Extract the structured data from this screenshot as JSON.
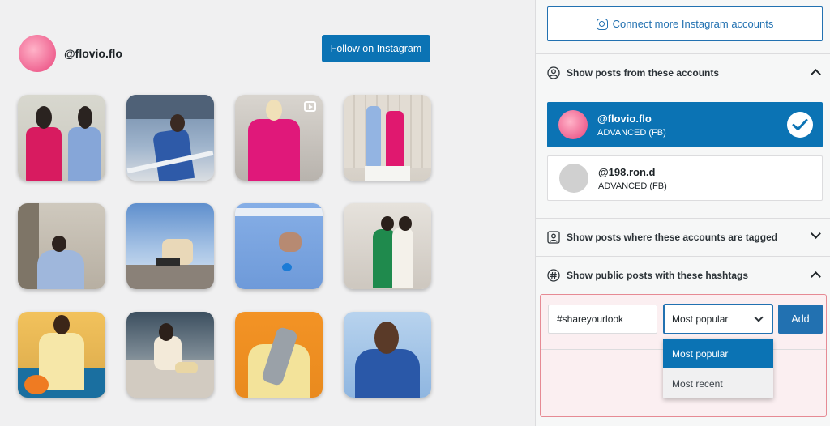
{
  "preview": {
    "username": "@flovio.flo",
    "follow_label": "Follow on Instagram"
  },
  "panel": {
    "connect_label": "Connect more Instagram accounts",
    "sections": {
      "accounts": "Show posts from these accounts",
      "tagged": "Show posts where these accounts are tagged",
      "hashtags": "Show public posts with these hashtags"
    },
    "accounts": [
      {
        "name": "@flovio.flo",
        "type": "ADVANCED (FB)",
        "selected": true
      },
      {
        "name": "@198.ron.d",
        "type": "ADVANCED (FB)",
        "selected": false
      }
    ],
    "hashtag": {
      "input_value": "#shareyourlook",
      "selected_option": "Most popular",
      "options": [
        "Most popular",
        "Most recent"
      ],
      "add_label": "Add"
    }
  },
  "colors": {
    "accent": "#0b73b4",
    "link": "#2271b1",
    "error_border": "#e68a94"
  },
  "icons": {
    "instagram": "instagram-icon",
    "user": "user-circle-icon",
    "tagged": "tagged-user-icon",
    "hashtag": "hashtag-icon",
    "check": "check-icon"
  }
}
